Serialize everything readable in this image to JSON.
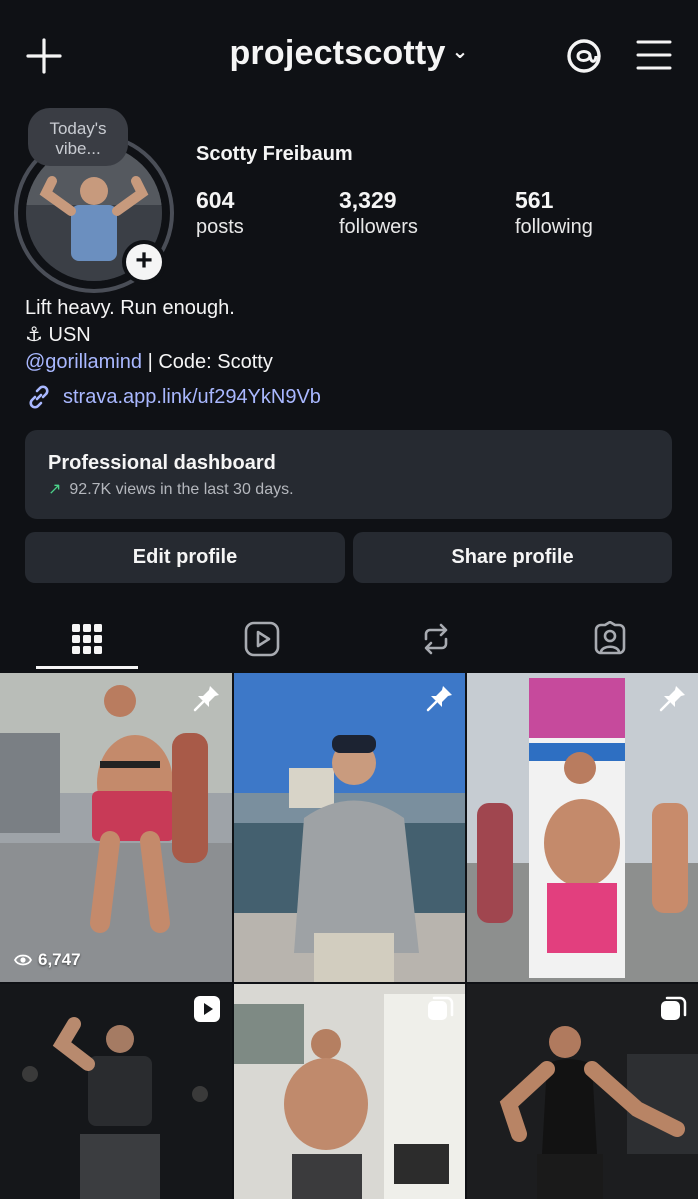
{
  "header": {
    "username": "projectscotty",
    "caret": "⌄",
    "create_icon": "plus-icon",
    "threads_icon": "threads-icon",
    "menu_icon": "hamburger-menu-icon"
  },
  "profile": {
    "vibe_note": "Today's vibe...",
    "full_name": "Scotty Freibaum",
    "stats": [
      {
        "value": "604",
        "label": "posts"
      },
      {
        "value": "3,329",
        "label": "followers"
      },
      {
        "value": "561",
        "label": "following"
      }
    ],
    "bio": {
      "line1": "Lift heavy. Run enough.",
      "line2_icon": "⚓",
      "line2_text": "USN",
      "mention": "@gorillamind",
      "line3_rest": " | Code: Scotty"
    },
    "link": "strava.app.link/uf294YkN9Vb"
  },
  "dashboard": {
    "title": "Professional dashboard",
    "arrow": "↗",
    "subtitle": "92.7K views in the last 30 days."
  },
  "buttons": {
    "edit": "Edit profile",
    "share": "Share profile"
  },
  "tabs": [
    "grid-icon",
    "reels-icon",
    "reposts-icon",
    "tagged-icon"
  ],
  "posts": [
    {
      "badge": "pin-icon",
      "views": "6,747"
    },
    {
      "badge": "pin-icon"
    },
    {
      "badge": "pin-icon"
    },
    {
      "badge": "reel-icon"
    },
    {
      "badge": "carousel-icon"
    },
    {
      "badge": "carousel-icon"
    }
  ],
  "colors": {
    "background": "#0f1115",
    "card": "#262a31",
    "link": "#a9b8ff",
    "growth": "#4cd38a"
  }
}
